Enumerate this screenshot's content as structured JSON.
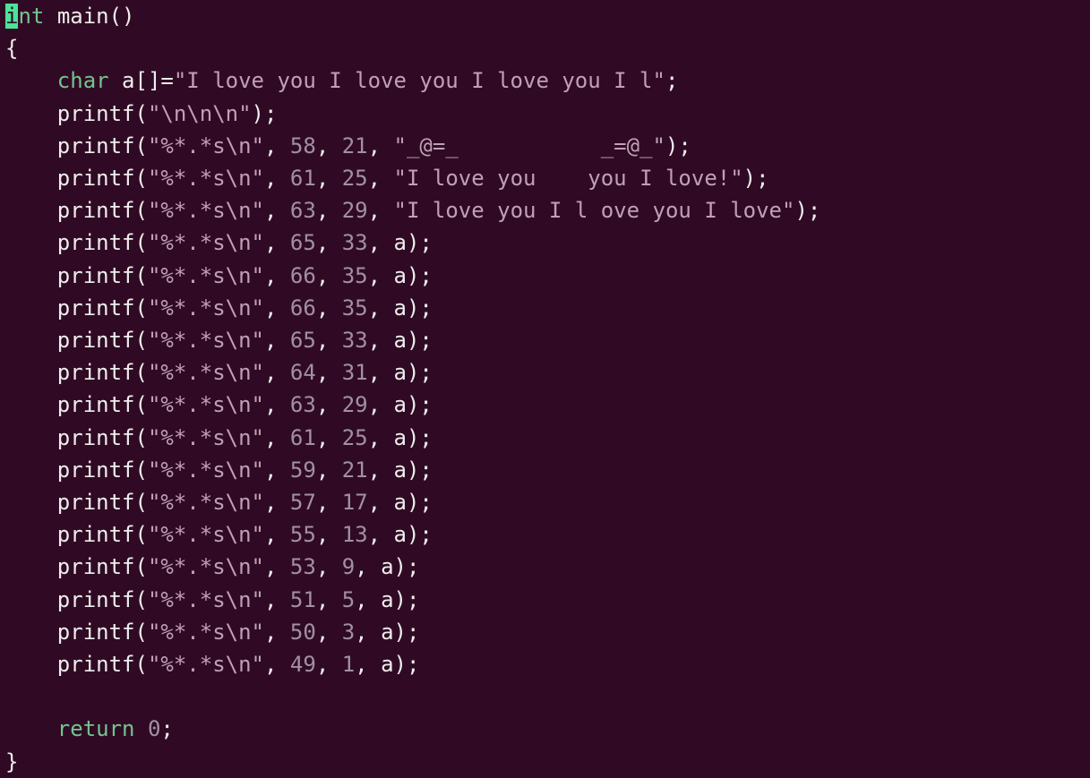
{
  "l1": {
    "kw1": "i",
    "kw2": "nt",
    "sp": " ",
    "fn": "main",
    "p": "()"
  },
  "l2": {
    "t": "{"
  },
  "l3": {
    "ind": "    ",
    "kw": "char",
    "sp": " ",
    "var": "a",
    "br": "[]=",
    "str": "\"I love you I love you I love you I l\"",
    "end": ";"
  },
  "l4": {
    "ind": "    ",
    "fn": "printf",
    "open": "(",
    "str": "\"\\n\\n\\n\"",
    "close": ");"
  },
  "l5": {
    "ind": "    ",
    "fn": "printf",
    "open": "(",
    "s1": "\"%*.*s\\n\"",
    "c1": ", ",
    "n1": "58",
    "c2": ", ",
    "n2": "21",
    "c3": ", ",
    "s2": "\"_@=_           _=@_\"",
    "close": ");"
  },
  "l6": {
    "ind": "    ",
    "fn": "printf",
    "open": "(",
    "s1": "\"%*.*s\\n\"",
    "c1": ", ",
    "n1": "61",
    "c2": ", ",
    "n2": "25",
    "c3": ", ",
    "s2": "\"I love you    you I love!\"",
    "close": ");"
  },
  "l7": {
    "ind": "    ",
    "fn": "printf",
    "open": "(",
    "s1": "\"%*.*s\\n\"",
    "c1": ", ",
    "n1": "63",
    "c2": ", ",
    "n2": "29",
    "c3": ", ",
    "s2": "\"I love you I l ove you I love\"",
    "close": ");"
  },
  "l8": {
    "ind": "    ",
    "fn": "printf",
    "open": "(",
    "s1": "\"%*.*s\\n\"",
    "c1": ", ",
    "n1": "65",
    "c2": ", ",
    "n2": "33",
    "c3": ", ",
    "v": "a",
    "close": ");"
  },
  "l9": {
    "ind": "    ",
    "fn": "printf",
    "open": "(",
    "s1": "\"%*.*s\\n\"",
    "c1": ", ",
    "n1": "66",
    "c2": ", ",
    "n2": "35",
    "c3": ", ",
    "v": "a",
    "close": ");"
  },
  "l10": {
    "ind": "    ",
    "fn": "printf",
    "open": "(",
    "s1": "\"%*.*s\\n\"",
    "c1": ", ",
    "n1": "66",
    "c2": ", ",
    "n2": "35",
    "c3": ", ",
    "v": "a",
    "close": ");"
  },
  "l11": {
    "ind": "    ",
    "fn": "printf",
    "open": "(",
    "s1": "\"%*.*s\\n\"",
    "c1": ", ",
    "n1": "65",
    "c2": ", ",
    "n2": "33",
    "c3": ", ",
    "v": "a",
    "close": ");"
  },
  "l12": {
    "ind": "    ",
    "fn": "printf",
    "open": "(",
    "s1": "\"%*.*s\\n\"",
    "c1": ", ",
    "n1": "64",
    "c2": ", ",
    "n2": "31",
    "c3": ", ",
    "v": "a",
    "close": ");"
  },
  "l13": {
    "ind": "    ",
    "fn": "printf",
    "open": "(",
    "s1": "\"%*.*s\\n\"",
    "c1": ", ",
    "n1": "63",
    "c2": ", ",
    "n2": "29",
    "c3": ", ",
    "v": "a",
    "close": ");"
  },
  "l14": {
    "ind": "    ",
    "fn": "printf",
    "open": "(",
    "s1": "\"%*.*s\\n\"",
    "c1": ", ",
    "n1": "61",
    "c2": ", ",
    "n2": "25",
    "c3": ", ",
    "v": "a",
    "close": ");"
  },
  "l15": {
    "ind": "    ",
    "fn": "printf",
    "open": "(",
    "s1": "\"%*.*s\\n\"",
    "c1": ", ",
    "n1": "59",
    "c2": ", ",
    "n2": "21",
    "c3": ", ",
    "v": "a",
    "close": ");"
  },
  "l16": {
    "ind": "    ",
    "fn": "printf",
    "open": "(",
    "s1": "\"%*.*s\\n\"",
    "c1": ", ",
    "n1": "57",
    "c2": ", ",
    "n2": "17",
    "c3": ", ",
    "v": "a",
    "close": ");"
  },
  "l17": {
    "ind": "    ",
    "fn": "printf",
    "open": "(",
    "s1": "\"%*.*s\\n\"",
    "c1": ", ",
    "n1": "55",
    "c2": ", ",
    "n2": "13",
    "c3": ", ",
    "v": "a",
    "close": ");"
  },
  "l18": {
    "ind": "    ",
    "fn": "printf",
    "open": "(",
    "s1": "\"%*.*s\\n\"",
    "c1": ", ",
    "n1": "53",
    "c2": ", ",
    "n2": "9",
    "c3": ", ",
    "v": "a",
    "close": ");"
  },
  "l19": {
    "ind": "    ",
    "fn": "printf",
    "open": "(",
    "s1": "\"%*.*s\\n\"",
    "c1": ", ",
    "n1": "51",
    "c2": ", ",
    "n2": "5",
    "c3": ", ",
    "v": "a",
    "close": ");"
  },
  "l20": {
    "ind": "    ",
    "fn": "printf",
    "open": "(",
    "s1": "\"%*.*s\\n\"",
    "c1": ", ",
    "n1": "50",
    "c2": ", ",
    "n2": "3",
    "c3": ", ",
    "v": "a",
    "close": ");"
  },
  "l21": {
    "ind": "    ",
    "fn": "printf",
    "open": "(",
    "s1": "\"%*.*s\\n\"",
    "c1": ", ",
    "n1": "49",
    "c2": ", ",
    "n2": "1",
    "c3": ", ",
    "v": "a",
    "close": ");"
  },
  "l22": {
    "t": ""
  },
  "l23": {
    "ind": "    ",
    "kw": "return",
    "sp": " ",
    "n": "0",
    "end": ";"
  },
  "l24": {
    "t": "}"
  }
}
